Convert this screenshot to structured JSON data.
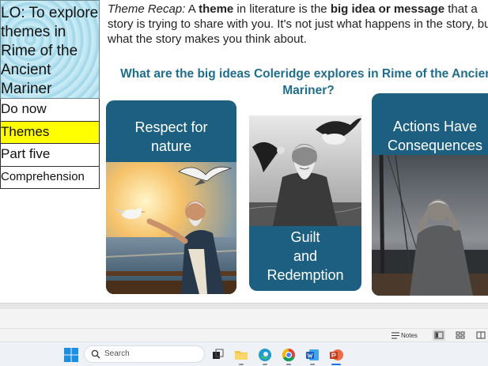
{
  "slide": {
    "objective": "LO: To explore\nthemes in\nRime of the\nAncient\nMariner",
    "nav": [
      {
        "label": "Do now",
        "active": false
      },
      {
        "label": "Themes",
        "active": true
      },
      {
        "label": "Part five",
        "active": false
      },
      {
        "label": "Comprehension",
        "active": false
      }
    ],
    "recap": {
      "line1": {
        "lead": "Theme Recap:",
        "t1": " A ",
        "b1": "theme",
        "t2": " in literature is the ",
        "b2": "big idea or message",
        "t3": " that a"
      },
      "line2": "story is trying to share with you. It's not just what happens in the story, but",
      "line3": "what the story makes you think about."
    },
    "question": "What are the big ideas Coleridge explores in Rime of the Ancient Mariner?",
    "cards": [
      {
        "title": "Respect for\nnature"
      },
      {
        "title": "Guilt\nand\nRedemption"
      },
      {
        "title": "Actions Have\nConsequences"
      }
    ]
  },
  "statusbar": {
    "notes_label": "Notes"
  },
  "taskbar": {
    "search_placeholder": "Search",
    "apps": [
      "start",
      "task-view",
      "file-explorer",
      "edge",
      "chrome",
      "word",
      "powerpoint"
    ]
  },
  "colors": {
    "card": "#1c5f80",
    "question": "#1f6d8c",
    "highlight": "#ffff00",
    "accent": "#1a73e8"
  }
}
